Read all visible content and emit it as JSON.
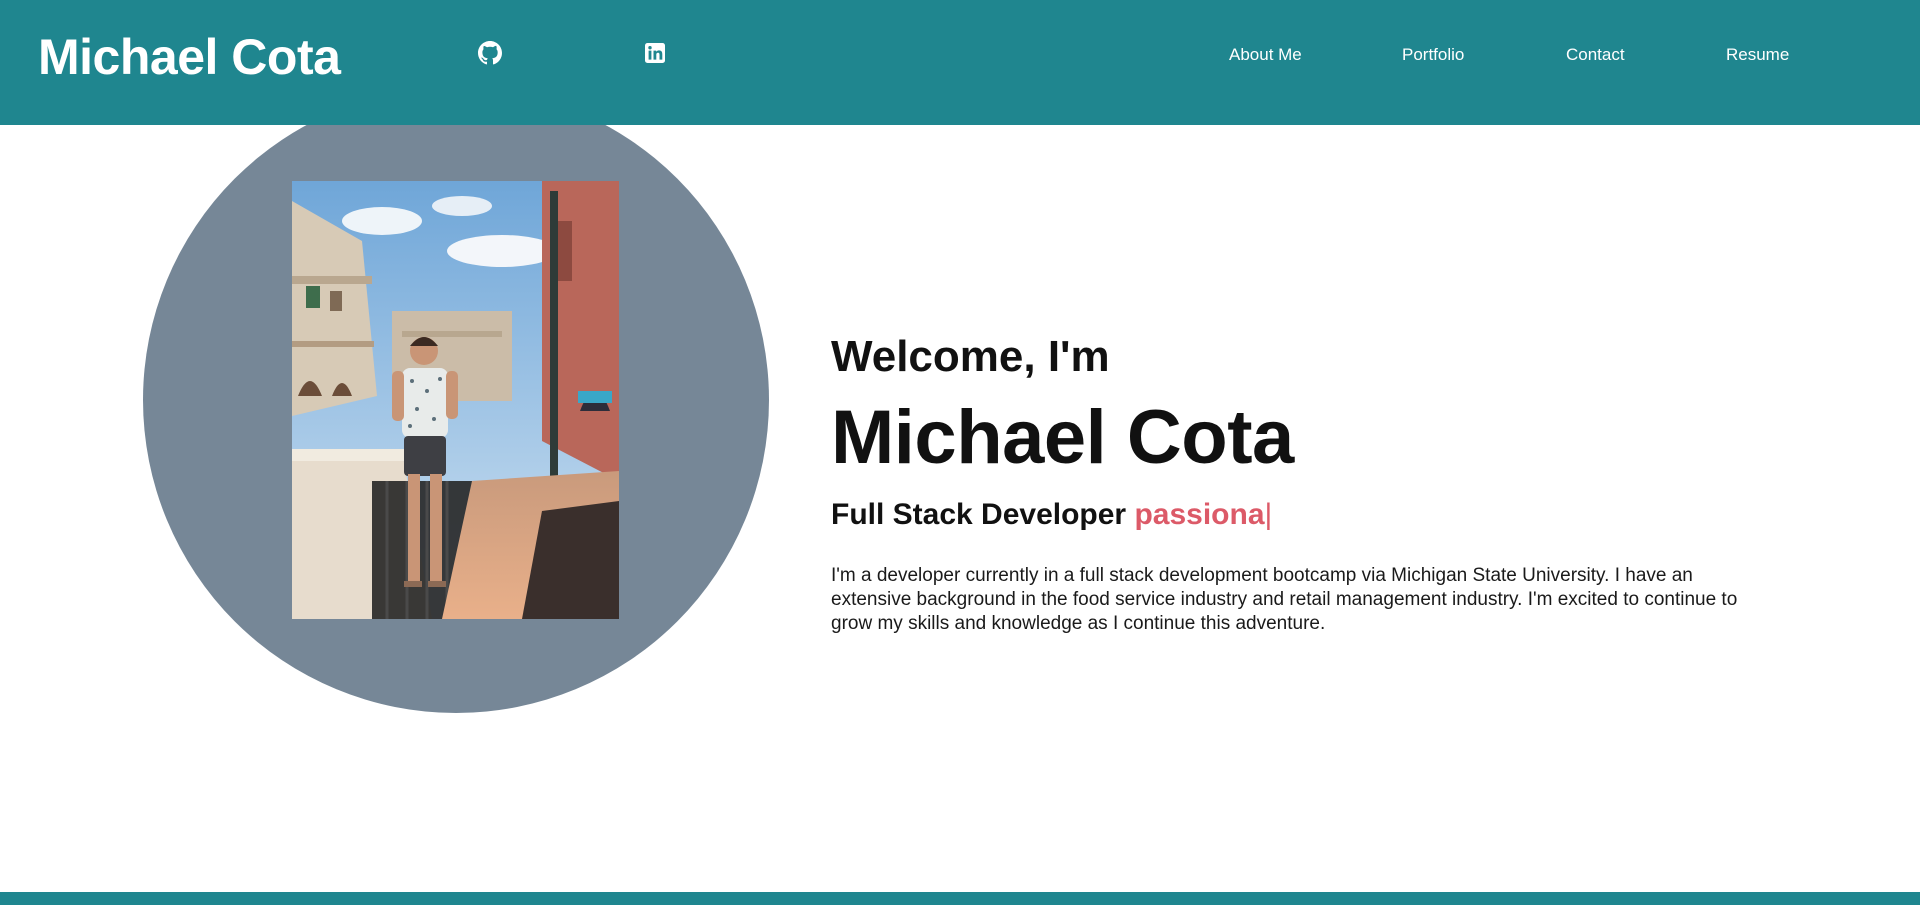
{
  "header": {
    "brand": "Michael Cota",
    "social": [
      {
        "name": "GitHub",
        "icon": "github-icon"
      },
      {
        "name": "LinkedIn",
        "icon": "linkedin-icon"
      }
    ],
    "nav": [
      "About Me",
      "Portfolio",
      "Contact",
      "Resume"
    ]
  },
  "hero": {
    "welcome": "Welcome, I'm",
    "name": "Michael Cota",
    "role_prefix": "Full Stack Developer",
    "role_typed": "passiona",
    "cursor": "|",
    "bio": "I'm a developer currently in a full stack development bootcamp via Michigan State University. I have an extensive background in the food service industry and retail management industry. I'm excited to continue to grow my skills and knowledge as I continue this adventure."
  },
  "colors": {
    "header_bg": "#1f868f",
    "avatar_circle": "#768797",
    "accent": "#dc5a68",
    "text": "#111111"
  }
}
